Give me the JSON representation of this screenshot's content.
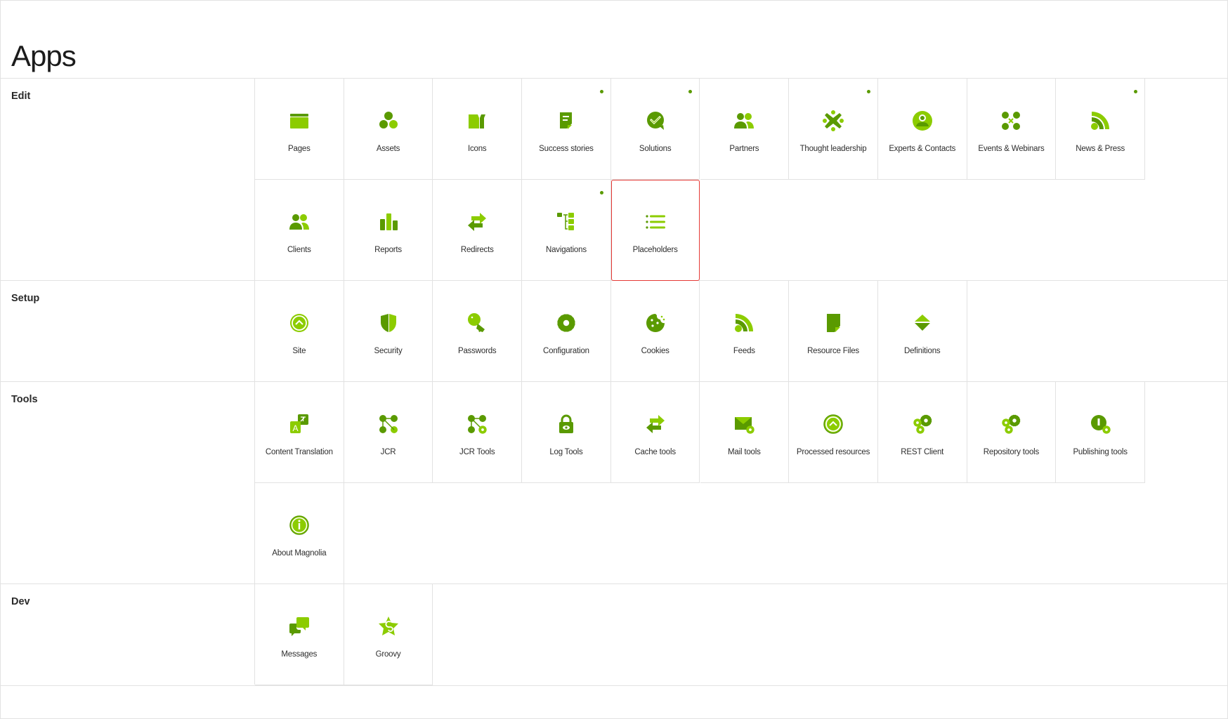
{
  "page": {
    "title": "Apps"
  },
  "colors": {
    "light": "#8ccc00",
    "dark": "#5a9a00",
    "selected_border": "#e53935",
    "new_dot": "#5a9a00"
  },
  "sections": [
    {
      "label": "Edit",
      "rows": 2,
      "apps": [
        {
          "label": "Pages",
          "icon": "pages-icon",
          "new": false
        },
        {
          "label": "Assets",
          "icon": "assets-icon",
          "new": false
        },
        {
          "label": "Icons",
          "icon": "icons-icon",
          "new": false
        },
        {
          "label": "Success stories",
          "icon": "success-stories-icon",
          "new": true
        },
        {
          "label": "Solutions",
          "icon": "solutions-icon",
          "new": true
        },
        {
          "label": "Partners",
          "icon": "partners-icon",
          "new": false
        },
        {
          "label": "Thought leadership",
          "icon": "thought-leadership-icon",
          "new": true
        },
        {
          "label": "Experts & Contacts",
          "icon": "experts-contacts-icon",
          "new": false
        },
        {
          "label": "Events & Webinars",
          "icon": "events-webinars-icon",
          "new": false
        },
        {
          "label": "News & Press",
          "icon": "news-press-icon",
          "new": true
        },
        {
          "label": "Clients",
          "icon": "clients-icon",
          "new": false
        },
        {
          "label": "Reports",
          "icon": "reports-icon",
          "new": false
        },
        {
          "label": "Redirects",
          "icon": "redirects-icon",
          "new": false
        },
        {
          "label": "Navigations",
          "icon": "navigations-icon",
          "new": true
        },
        {
          "label": "Placeholders",
          "icon": "placeholders-icon",
          "new": false,
          "selected": true
        }
      ]
    },
    {
      "label": "Setup",
      "rows": 1,
      "apps": [
        {
          "label": "Site",
          "icon": "site-icon",
          "new": false
        },
        {
          "label": "Security",
          "icon": "security-icon",
          "new": false
        },
        {
          "label": "Passwords",
          "icon": "passwords-icon",
          "new": false
        },
        {
          "label": "Configuration",
          "icon": "configuration-icon",
          "new": false
        },
        {
          "label": "Cookies",
          "icon": "cookies-icon",
          "new": false
        },
        {
          "label": "Feeds",
          "icon": "feeds-icon",
          "new": false
        },
        {
          "label": "Resource Files",
          "icon": "resource-files-icon",
          "new": false
        },
        {
          "label": "Definitions",
          "icon": "definitions-icon",
          "new": false
        }
      ]
    },
    {
      "label": "Tools",
      "rows": 2,
      "apps": [
        {
          "label": "Content Translation",
          "icon": "content-translation-icon",
          "new": false
        },
        {
          "label": "JCR",
          "icon": "jcr-icon",
          "new": false
        },
        {
          "label": "JCR Tools",
          "icon": "jcr-tools-icon",
          "new": false
        },
        {
          "label": "Log Tools",
          "icon": "log-tools-icon",
          "new": false
        },
        {
          "label": "Cache tools",
          "icon": "cache-tools-icon",
          "new": false
        },
        {
          "label": "Mail tools",
          "icon": "mail-tools-icon",
          "new": false
        },
        {
          "label": "Processed resources",
          "icon": "processed-resources-icon",
          "new": false
        },
        {
          "label": "REST Client",
          "icon": "rest-client-icon",
          "new": false
        },
        {
          "label": "Repository tools",
          "icon": "repository-tools-icon",
          "new": false
        },
        {
          "label": "Publishing tools",
          "icon": "publishing-tools-icon",
          "new": false
        },
        {
          "label": "About Magnolia",
          "icon": "about-magnolia-icon",
          "new": false
        }
      ]
    },
    {
      "label": "Dev",
      "rows": 1,
      "apps": [
        {
          "label": "Messages",
          "icon": "messages-icon",
          "new": false
        },
        {
          "label": "Groovy",
          "icon": "groovy-icon",
          "new": false
        }
      ]
    }
  ]
}
